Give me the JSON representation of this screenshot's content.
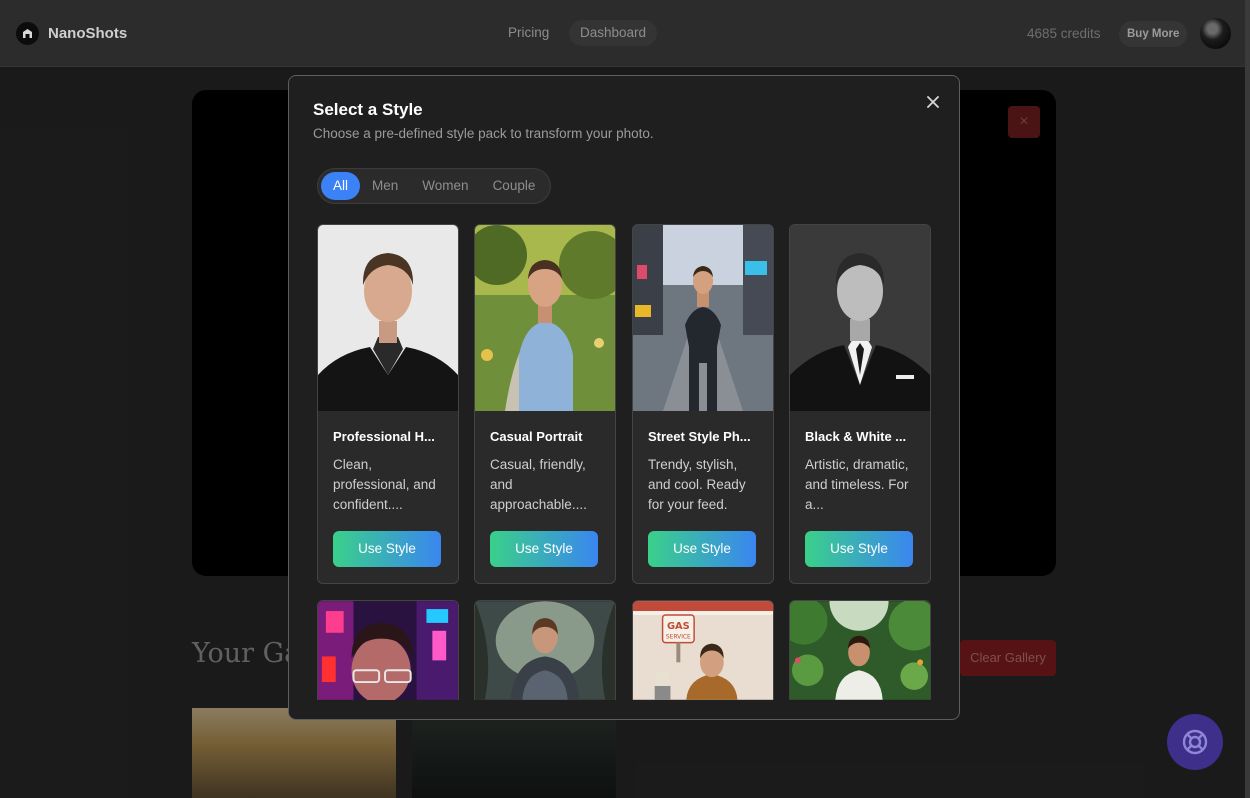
{
  "header": {
    "brand": "NanoShots",
    "nav": [
      "Pricing",
      "Dashboard"
    ],
    "credits": "4685 credits",
    "buy_more": "Buy More"
  },
  "background": {
    "close_glyph": "×",
    "gallery_title": "Your Gall",
    "clear_gallery": "Clear Gallery"
  },
  "modal": {
    "title": "Select a Style",
    "subtitle": "Choose a pre-defined style pack to transform your photo.",
    "close_icon": "close-icon",
    "tabs": [
      {
        "label": "All",
        "active": true
      },
      {
        "label": "Men",
        "active": false
      },
      {
        "label": "Women",
        "active": false
      },
      {
        "label": "Couple",
        "active": false
      }
    ],
    "cards": [
      {
        "title": "Professional H...",
        "desc": "Clean, professional, and confident....",
        "button": "Use Style"
      },
      {
        "title": "Casual Portrait",
        "desc": "Casual, friendly, and approachable....",
        "button": "Use Style"
      },
      {
        "title": "Street Style Ph...",
        "desc": "Trendy, stylish, and cool. Ready for your feed.",
        "button": "Use Style"
      },
      {
        "title": "Black & White ...",
        "desc": "Artistic, dramatic, and timeless. For a...",
        "button": "Use Style"
      }
    ],
    "row2_badge": [
      "GAS",
      "SERVICE"
    ]
  },
  "colors": {
    "accent_blue": "#3a82f6",
    "button_gradient_start": "#3ad08a",
    "button_gradient_end": "#3a86f0",
    "danger": "#7d1c1c",
    "help_button": "#3d2f8a"
  }
}
